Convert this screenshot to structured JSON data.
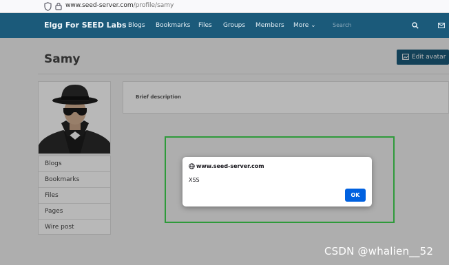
{
  "browser": {
    "url_host": "www.seed-server.com",
    "url_path": "/profile/samy"
  },
  "nav": {
    "brand": "Elgg For SEED Labs",
    "items": [
      "Blogs",
      "Bookmarks",
      "Files",
      "Groups",
      "Members",
      "More ⌄"
    ],
    "search_placeholder": "Search",
    "icons": [
      "search-icon",
      "mail-icon"
    ]
  },
  "profile": {
    "name": "Samy",
    "edit_avatar_label": "Edit avatar",
    "brief_description_label": "Brief description"
  },
  "sidebar": {
    "items": [
      "Blogs",
      "Bookmarks",
      "Files",
      "Pages",
      "Wire post"
    ]
  },
  "dialog": {
    "host": "www.seed-server.com",
    "message": "XSS",
    "ok_label": "OK"
  },
  "watermark": "CSDN @whalien__52",
  "colors": {
    "nav_bg": "#1b5a7a",
    "ok_button": "#0061e0",
    "highlight_frame": "#2e9a3a"
  }
}
